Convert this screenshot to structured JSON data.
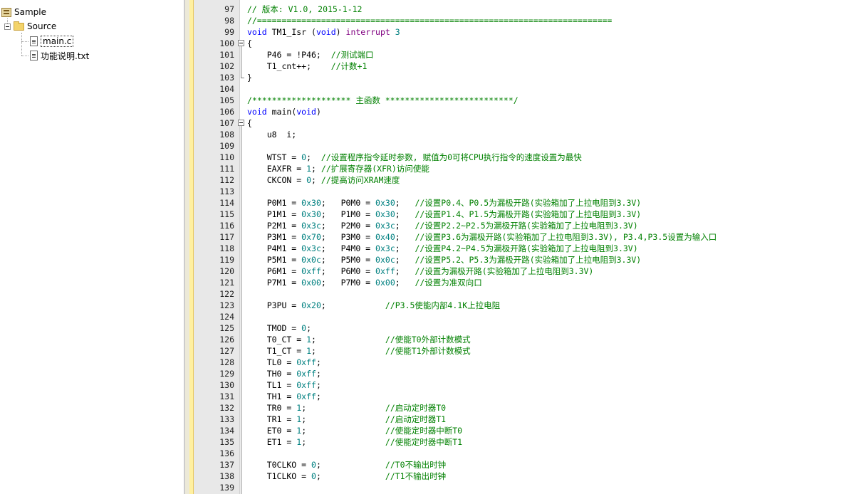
{
  "project_tree": {
    "root_label": "Sample",
    "group_label": "Source",
    "files": [
      {
        "label": "main.c",
        "selected": true
      },
      {
        "label": "功能说明.txt",
        "selected": false
      }
    ]
  },
  "colors": {
    "comment": "#008000",
    "keyword": "#0000ff",
    "interrupt_keyword": "#800080",
    "number": "#008080",
    "gutter": "#e8e8e8"
  },
  "editor": {
    "lines": [
      {
        "n": "97",
        "t": "// 版本: V1.0, 2015-1-12"
      },
      {
        "n": "98",
        "t": "//========================================================================"
      },
      {
        "n": "99",
        "t": "void TM1_Isr (void) interrupt 3"
      },
      {
        "n": "100",
        "t": "{"
      },
      {
        "n": "101",
        "t": "    P46 = !P46;  //测试端口"
      },
      {
        "n": "102",
        "t": "    T1_cnt++;    //计数+1"
      },
      {
        "n": "103",
        "t": "}"
      },
      {
        "n": "104",
        "t": ""
      },
      {
        "n": "105",
        "t": "/******************** 主函数 **************************/"
      },
      {
        "n": "106",
        "t": "void main(void)"
      },
      {
        "n": "107",
        "t": "{"
      },
      {
        "n": "108",
        "t": "    u8  i;"
      },
      {
        "n": "109",
        "t": ""
      },
      {
        "n": "110",
        "t": "    WTST = 0;  //设置程序指令延时参数, 赋值为0可将CPU执行指令的速度设置为最快"
      },
      {
        "n": "111",
        "t": "    EAXFR = 1; //扩展寄存器(XFR)访问使能"
      },
      {
        "n": "112",
        "t": "    CKCON = 0; //提高访问XRAM速度"
      },
      {
        "n": "113",
        "t": ""
      },
      {
        "n": "114",
        "t": "    P0M1 = 0x30;   P0M0 = 0x30;   //设置P0.4、P0.5为漏极开路(实验箱加了上拉电阻到3.3V)"
      },
      {
        "n": "115",
        "t": "    P1M1 = 0x30;   P1M0 = 0x30;   //设置P1.4、P1.5为漏极开路(实验箱加了上拉电阻到3.3V)"
      },
      {
        "n": "116",
        "t": "    P2M1 = 0x3c;   P2M0 = 0x3c;   //设置P2.2~P2.5为漏极开路(实验箱加了上拉电阻到3.3V)"
      },
      {
        "n": "117",
        "t": "    P3M1 = 0x70;   P3M0 = 0x40;   //设置P3.6为漏极开路(实验箱加了上拉电阻到3.3V), P3.4,P3.5设置为输入口"
      },
      {
        "n": "118",
        "t": "    P4M1 = 0x3c;   P4M0 = 0x3c;   //设置P4.2~P4.5为漏极开路(实验箱加了上拉电阻到3.3V)"
      },
      {
        "n": "119",
        "t": "    P5M1 = 0x0c;   P5M0 = 0x0c;   //设置P5.2、P5.3为漏极开路(实验箱加了上拉电阻到3.3V)"
      },
      {
        "n": "120",
        "t": "    P6M1 = 0xff;   P6M0 = 0xff;   //设置为漏极开路(实验箱加了上拉电阻到3.3V)"
      },
      {
        "n": "121",
        "t": "    P7M1 = 0x00;   P7M0 = 0x00;   //设置为准双向口"
      },
      {
        "n": "122",
        "t": ""
      },
      {
        "n": "123",
        "t": "    P3PU = 0x20;            //P3.5使能内部4.1K上拉电阻"
      },
      {
        "n": "124",
        "t": ""
      },
      {
        "n": "125",
        "t": "    TMOD = 0;"
      },
      {
        "n": "126",
        "t": "    T0_CT = 1;              //使能T0外部计数模式"
      },
      {
        "n": "127",
        "t": "    T1_CT = 1;              //使能T1外部计数模式"
      },
      {
        "n": "128",
        "t": "    TL0 = 0xff;"
      },
      {
        "n": "129",
        "t": "    TH0 = 0xff;"
      },
      {
        "n": "130",
        "t": "    TL1 = 0xff;"
      },
      {
        "n": "131",
        "t": "    TH1 = 0xff;"
      },
      {
        "n": "132",
        "t": "    TR0 = 1;                //启动定时器T0"
      },
      {
        "n": "133",
        "t": "    TR1 = 1;                //启动定时器T1"
      },
      {
        "n": "134",
        "t": "    ET0 = 1;                //使能定时器中断T0"
      },
      {
        "n": "135",
        "t": "    ET1 = 1;                //使能定时器中断T1"
      },
      {
        "n": "136",
        "t": ""
      },
      {
        "n": "137",
        "t": "    T0CLKO = 0;             //T0不输出时钟"
      },
      {
        "n": "138",
        "t": "    T1CLKO = 0;             //T1不输出时钟"
      },
      {
        "n": "139",
        "t": ""
      }
    ]
  }
}
